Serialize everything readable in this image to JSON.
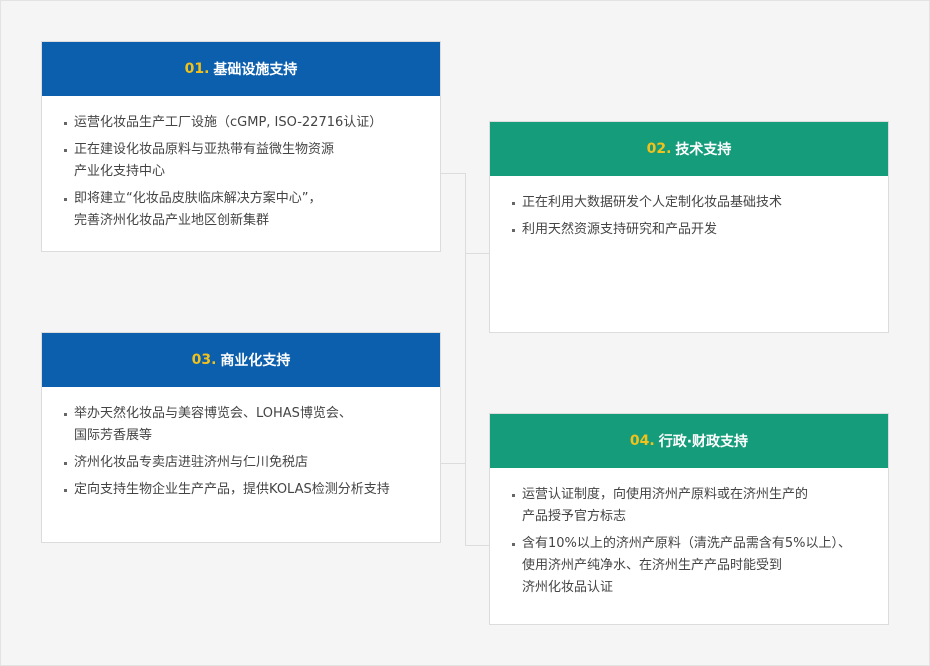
{
  "cards": [
    {
      "num": "01.",
      "title": "基础设施支持",
      "items": [
        [
          "运营化妆品生产工厂设施（cGMP, ISO-22716认证）"
        ],
        [
          "正在建设化妆品原料与亚热带有益微生物资源",
          "产业化支持中心"
        ],
        [
          "即将建立“化妆品皮肤临床解决方案中心”，",
          "完善济州化妆品产业地区创新集群"
        ]
      ]
    },
    {
      "num": "02.",
      "title": "技术支持",
      "items": [
        [
          "正在利用大数据研发个人定制化妆品基础技术"
        ],
        [
          "利用天然资源支持研究和产品开发"
        ]
      ]
    },
    {
      "num": "03.",
      "title": "商业化支持",
      "items": [
        [
          "举办天然化妆品与美容博览会、LOHAS博览会、",
          "国际芳香展等"
        ],
        [
          "济州化妆品专卖店进驻济州与仁川免税店"
        ],
        [
          "定向支持生物企业生产产品，提供KOLAS检测分析支持"
        ]
      ]
    },
    {
      "num": "04.",
      "title": "行政·财政支持",
      "items": [
        [
          "运营认证制度，向使用济州产原料或在济州生产的",
          "产品授予官方标志"
        ],
        [
          "含有10%以上的济州产原料（清洗产品需含有5%以上）、",
          "使用济州产纯净水、在济州生产产品时能受到",
          "济州化妆品认证"
        ]
      ]
    }
  ]
}
